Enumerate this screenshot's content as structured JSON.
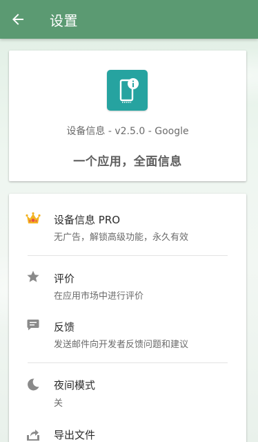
{
  "colors": {
    "toolbar": "#5b9a72",
    "app_icon_bg": "#26a3a0",
    "icon_gray": "#8a8a8a",
    "crown_gold": "#f3b321",
    "crown_red": "#e84b4b"
  },
  "toolbar": {
    "title": "设置",
    "back_icon": "arrow-back-icon"
  },
  "app_info": {
    "icon": "device-info-icon",
    "version": "设备信息 - v2.5.0 - Google",
    "slogan": "一个应用，全面信息"
  },
  "menu": {
    "items": [
      {
        "icon": "crown-icon",
        "title": "设备信息 PRO",
        "subtitle": "无广告，解锁高级功能，永久有效"
      },
      {
        "icon": "star-icon",
        "title": "评价",
        "subtitle": "在应用市场中进行评价"
      },
      {
        "icon": "feedback-icon",
        "title": "反馈",
        "subtitle": "发送邮件向开发者反馈问题和建议"
      },
      {
        "icon": "moon-icon",
        "title": "夜间模式",
        "subtitle": "关"
      },
      {
        "icon": "export-icon",
        "title": "导出文件",
        "subtitle": ""
      }
    ]
  }
}
